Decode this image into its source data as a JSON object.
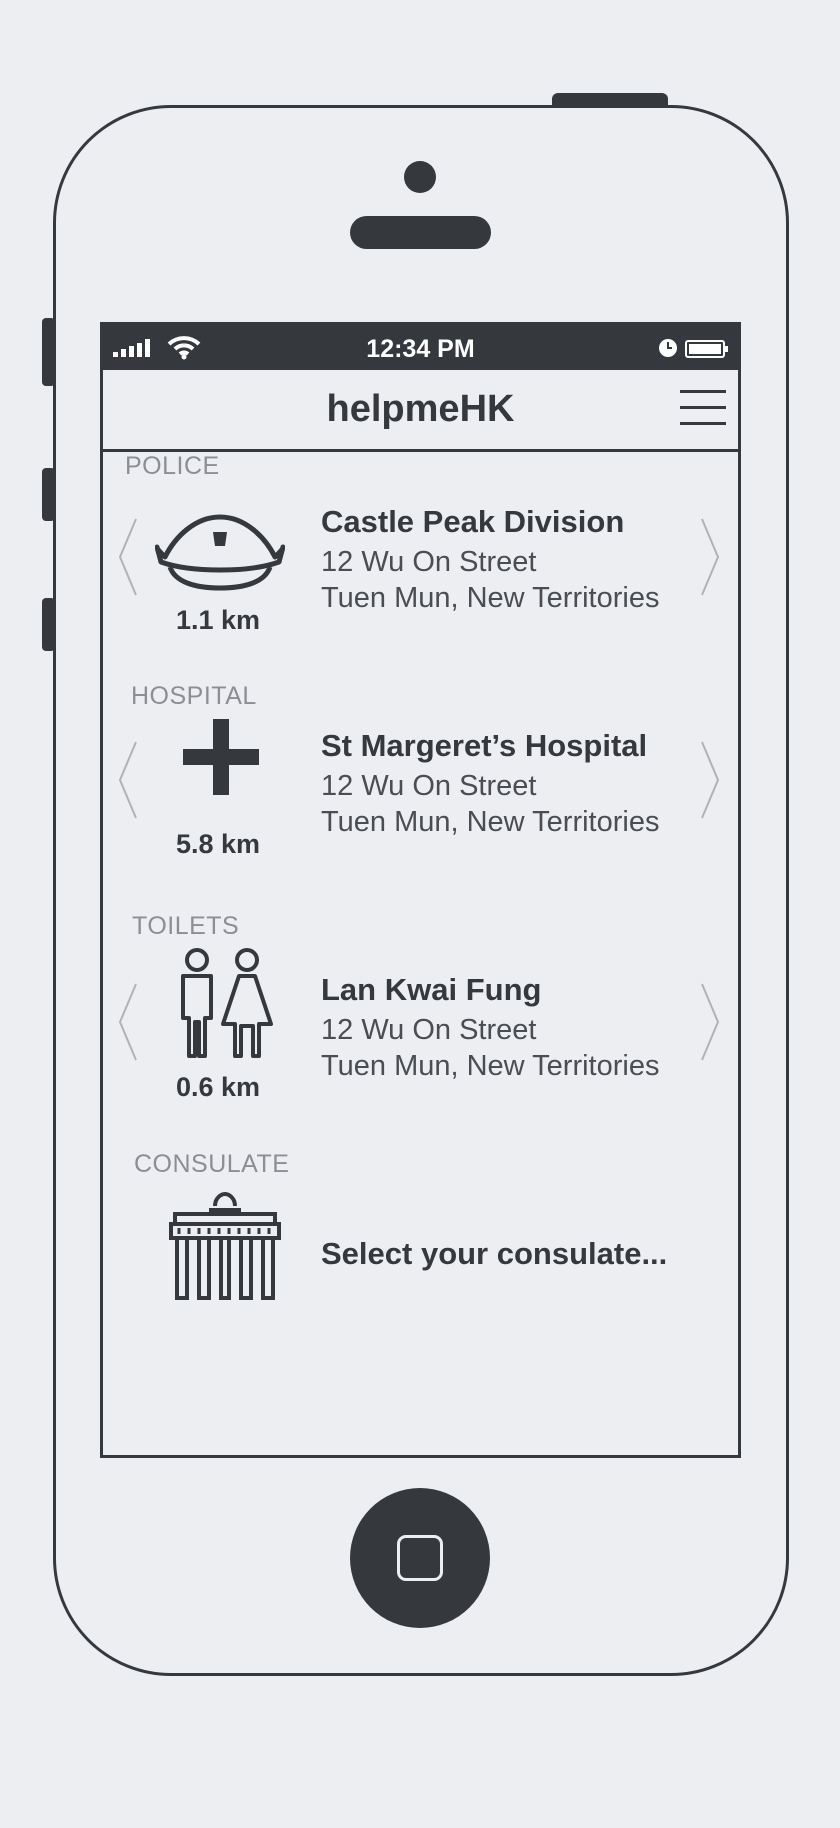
{
  "status_bar": {
    "time": "12:34 PM"
  },
  "header": {
    "title": "helpmeHK"
  },
  "sections": [
    {
      "category": "POLICE",
      "name": "Castle Peak Division",
      "address_line1": "12 Wu On Street",
      "address_line2": "Tuen Mun, New Territories",
      "distance": "1.1 km",
      "icon": "police-cap-icon"
    },
    {
      "category": "HOSPITAL",
      "name": "St Margeret’s Hospital",
      "address_line1": "12 Wu On Street",
      "address_line2": "Tuen Mun, New Territories",
      "distance": "5.8 km",
      "icon": "medical-cross-icon"
    },
    {
      "category": "TOILETS",
      "name": "Lan Kwai Fung",
      "address_line1": "12 Wu On Street",
      "address_line2": "Tuen Mun, New Territories",
      "distance": "0.6 km",
      "icon": "toilets-icon"
    },
    {
      "category": "CONSULATE",
      "name": "Select your consulate...",
      "icon": "consulate-gate-icon"
    }
  ],
  "colors": {
    "dark": "#35383d",
    "background": "#edeef1",
    "muted": "#8b8e93"
  }
}
